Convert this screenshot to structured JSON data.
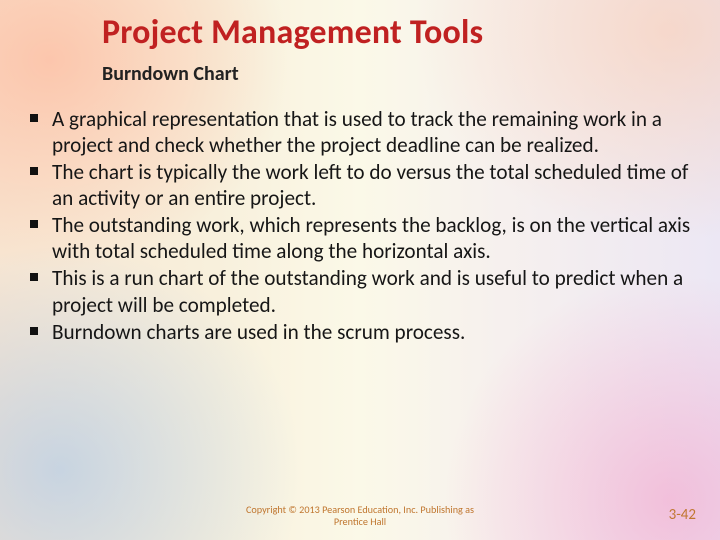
{
  "slide": {
    "title": "Project Management Tools",
    "subtitle": "Burndown Chart",
    "bullets": [
      "A graphical representation that is used to track the remaining work in a project and check whether the project deadline can be realized.",
      "The chart is typically the work left to do versus the total scheduled time of an activity or an entire project.",
      "The outstanding work, which represents the backlog, is on the vertical axis with total scheduled time along the horizontal axis.",
      "This is a run chart of the outstanding work and is useful to predict when a project will be completed.",
      "Burndown charts are used in the scrum process."
    ],
    "copyright": "Copyright © 2013 Pearson Education, Inc. Publishing as Prentice Hall",
    "page": "3-42"
  }
}
